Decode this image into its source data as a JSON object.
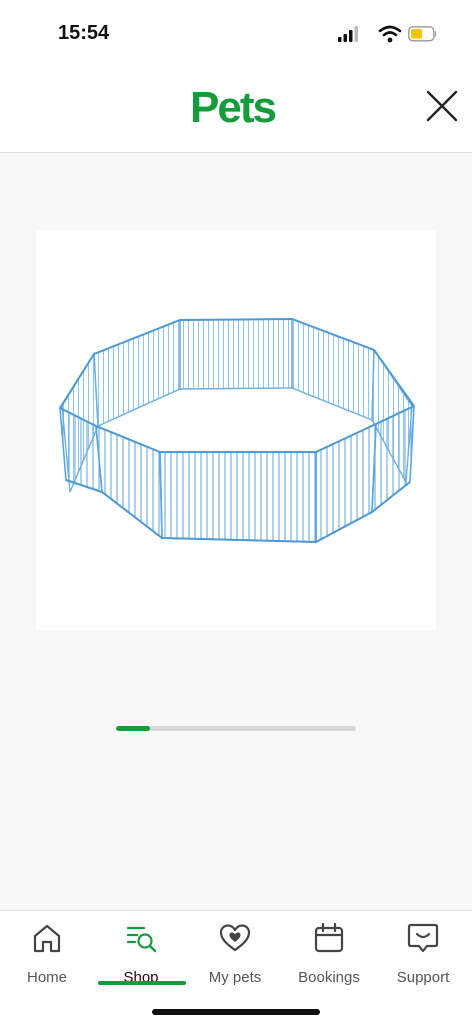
{
  "status_bar": {
    "time": "15:54",
    "icons": [
      "signal-icon",
      "wifi-icon",
      "battery-icon"
    ],
    "battery_color": "#f5c400"
  },
  "header": {
    "logo_text": "Pets",
    "brand_color": "#149b3b",
    "close_icon": "close-icon"
  },
  "product": {
    "image": "pet-playpen-image",
    "fence_color": "#6aaee0"
  },
  "carousel": {
    "progress": 0.14
  },
  "bottom_nav": {
    "items": [
      {
        "label": "Home",
        "icon": "home-icon",
        "active": false
      },
      {
        "label": "Shop",
        "icon": "shop-search-icon",
        "active": true
      },
      {
        "label": "My pets",
        "icon": "heart-icon",
        "active": false
      },
      {
        "label": "Bookings",
        "icon": "calendar-icon",
        "active": false
      },
      {
        "label": "Support",
        "icon": "chat-support-icon",
        "active": false
      }
    ],
    "active_color": "#149b3b"
  }
}
